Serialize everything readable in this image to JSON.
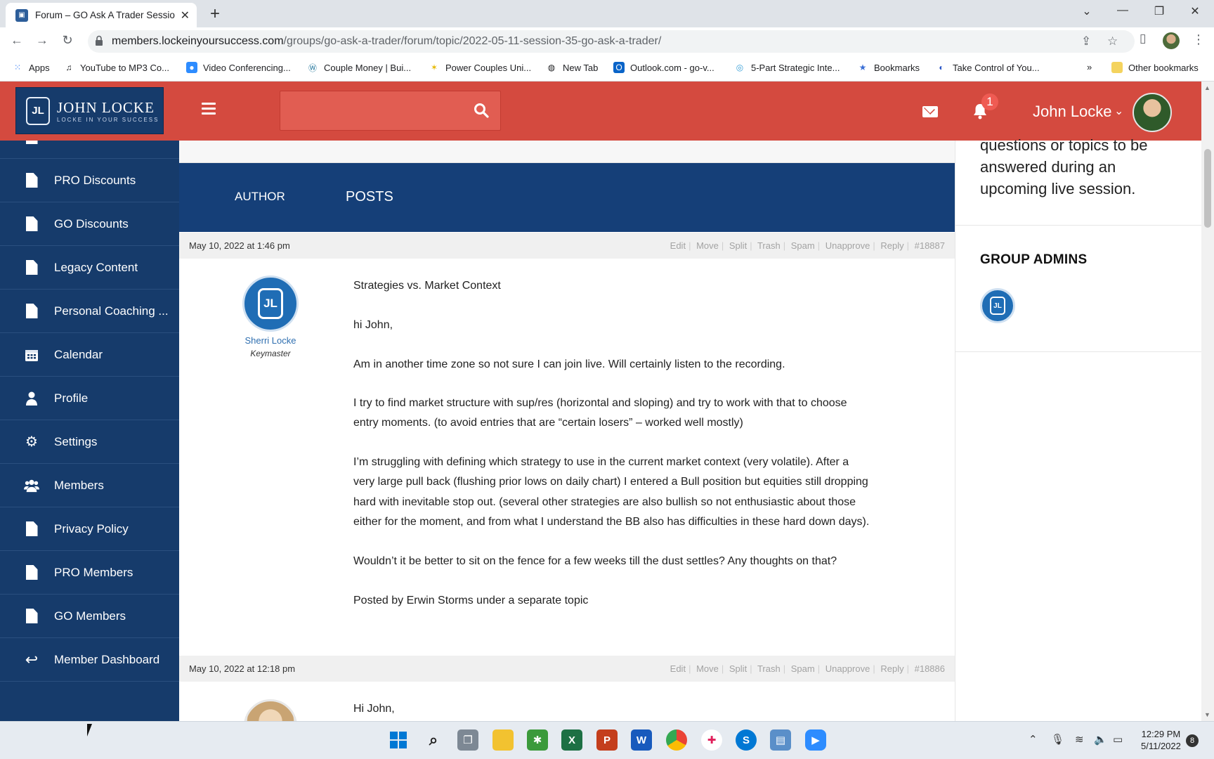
{
  "browser": {
    "tab_title": "Forum – GO Ask A Trader Session",
    "url_host": "members.lockeinyoursuccess.com",
    "url_path": "/groups/go-ask-a-trader/forum/topic/2022-05-11-session-35-go-ask-a-trader/",
    "bookmarks": [
      "Apps",
      "YouTube to MP3 Co...",
      "Video Conferencing...",
      "Couple Money | Bui...",
      "Power Couples Uni...",
      "New Tab",
      "Outlook.com - go-v...",
      "5-Part Strategic Inte...",
      "Bookmarks",
      "Take Control of You..."
    ],
    "bookmarks_overflow": "»",
    "other_bookmarks": "Other bookmarks"
  },
  "header": {
    "logo_name": "JOHN LOCKE",
    "logo_tagline": "LOCKE IN YOUR SUCCESS",
    "logo_monogram": "JL",
    "notification_count": "1",
    "user_name": "John Locke"
  },
  "sidebar": {
    "items": [
      {
        "label": "PRO Discounts",
        "icon": "document-icon"
      },
      {
        "label": "GO Discounts",
        "icon": "document-icon"
      },
      {
        "label": "Legacy Content",
        "icon": "document-icon"
      },
      {
        "label": "Personal Coaching ...",
        "icon": "document-icon"
      },
      {
        "label": "Calendar",
        "icon": "calendar-icon"
      },
      {
        "label": "Profile",
        "icon": "person-icon"
      },
      {
        "label": "Settings",
        "icon": "gears-icon"
      },
      {
        "label": "Members",
        "icon": "users-icon"
      },
      {
        "label": "Privacy Policy",
        "icon": "document-icon"
      },
      {
        "label": "PRO Members",
        "icon": "document-icon"
      },
      {
        "label": "GO Members",
        "icon": "document-icon"
      },
      {
        "label": "Member Dashboard",
        "icon": "reply-all-icon"
      }
    ]
  },
  "forum": {
    "col_author": "AUTHOR",
    "col_posts": "POSTS",
    "actions": [
      "Edit",
      "Move",
      "Split",
      "Trash",
      "Spam",
      "Unapprove",
      "Reply"
    ],
    "posts": [
      {
        "date": "May 10, 2022 at 1:46 pm",
        "id": "#18887",
        "author_name": "Sherri Locke",
        "author_role": "Keymaster",
        "lines": [
          "Strategies vs. Market Context",
          "hi John,",
          "Am in another time zone so not sure I can join live. Will certainly listen to the recording.",
          "I try to find market structure with sup/res (horizontal and sloping) and try to work with that to choose",
          "entry moments. (to avoid entries that are “certain losers” – worked well mostly)",
          "I’m struggling with defining which strategy to use in the current market context (very volatile). After a",
          "very large pull back (flushing prior lows on daily chart) I entered a Bull position but equities still dropping",
          "hard with inevitable stop out. (several other strategies are also bullish so not enthusiastic about those",
          "either for the moment, and from what I understand the BB also has difficulties in these hard down days).",
          "Wouldn’t it be better to sit on the fence for a few weeks till the dust settles? Any thoughts on that?",
          "Posted by Erwin Storms under a separate topic"
        ]
      },
      {
        "date": "May 10, 2022 at 12:18 pm",
        "id": "#18886",
        "first_line": "Hi John,"
      }
    ]
  },
  "rightbar": {
    "text_lines": [
      "questions or topics to be",
      "answered during an",
      "upcoming live session."
    ],
    "group_admins_heading": "GROUP ADMINS"
  },
  "taskbar": {
    "time": "12:29 PM",
    "date": "5/11/2022",
    "notification_count": "8"
  },
  "colors": {
    "header_red": "#d44a3f",
    "sidebar_navy": "#163b6b",
    "table_head_blue": "#153f78",
    "link_blue": "#2f6fb0"
  }
}
